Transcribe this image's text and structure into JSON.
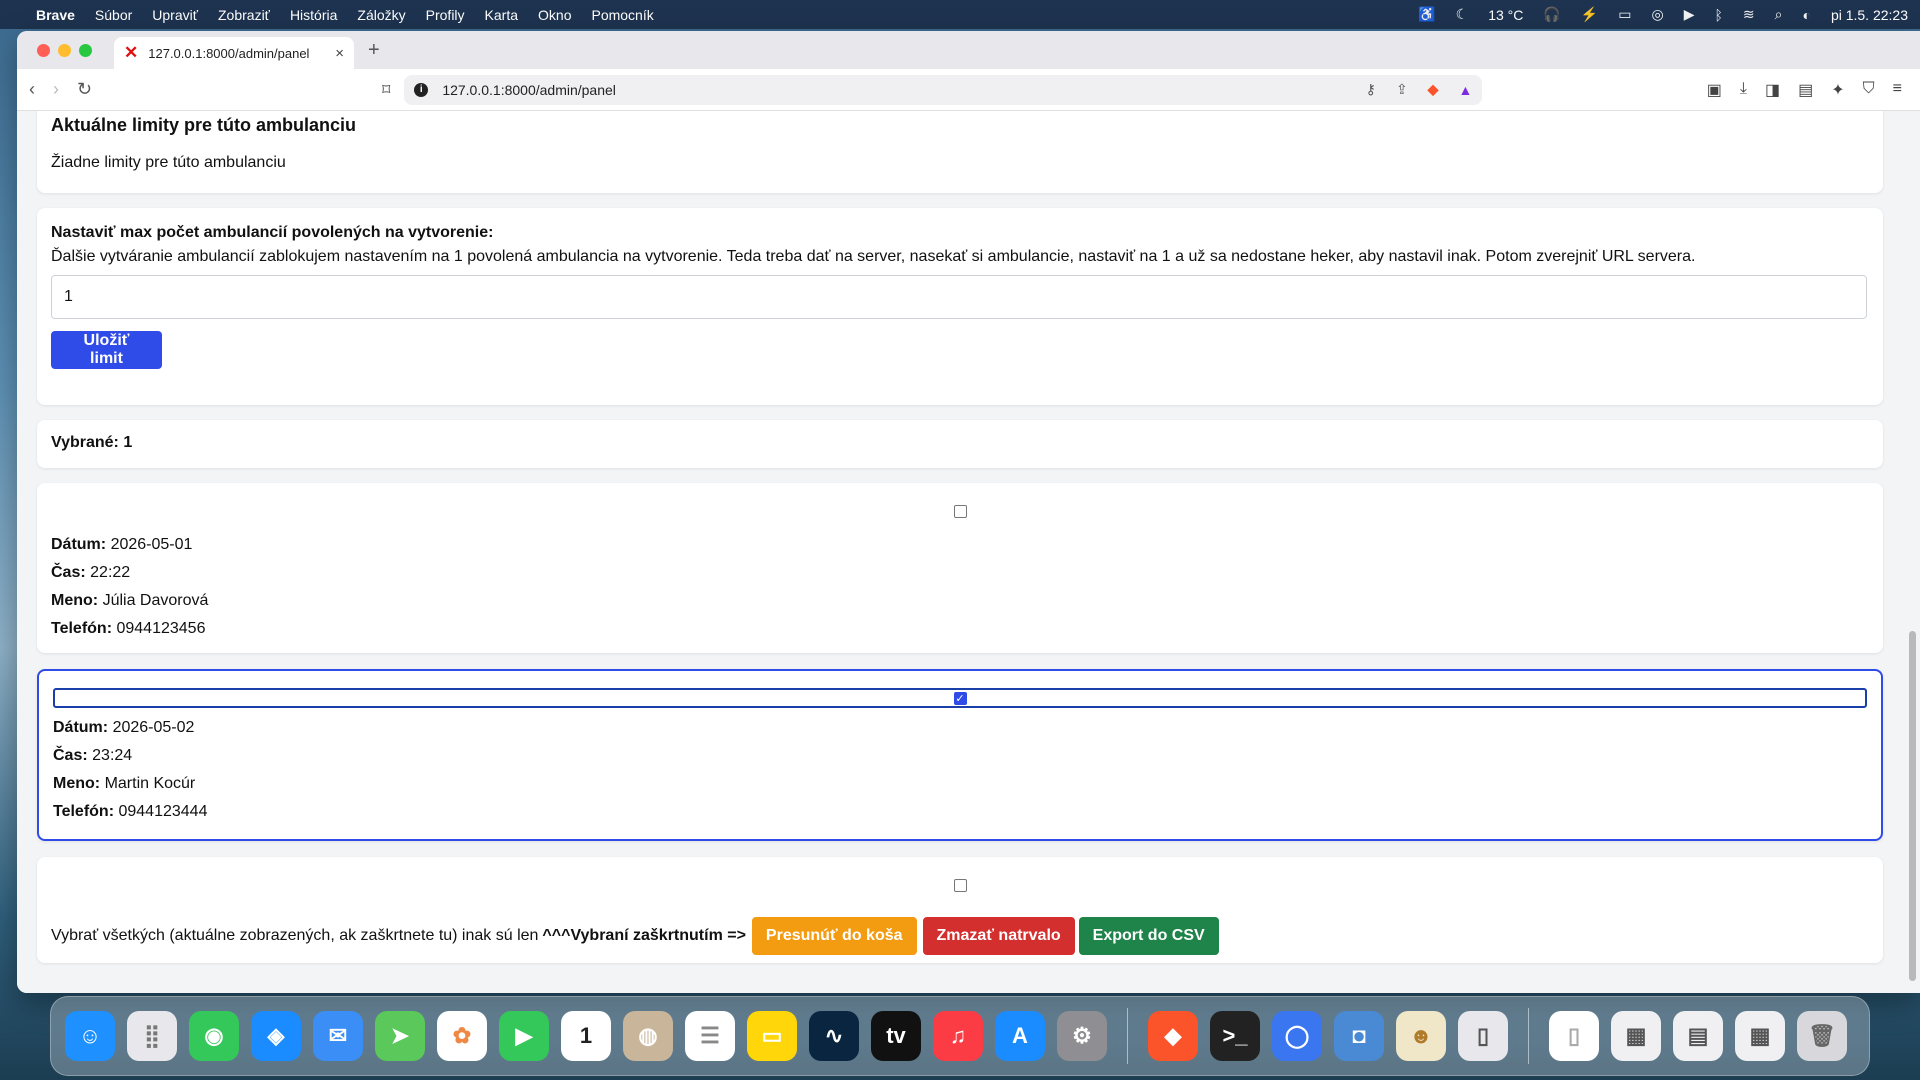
{
  "menubar": {
    "app": "Brave",
    "items": [
      "Súbor",
      "Upraviť",
      "Zobraziť",
      "História",
      "Záložky",
      "Profily",
      "Karta",
      "Okno",
      "Pomocník"
    ],
    "weather": "13 °C",
    "datetime": "pi 1.5.  22:23"
  },
  "browser": {
    "tab_title": "127.0.0.1:8000/admin/panel",
    "url": "127.0.0.1:8000/admin/panel"
  },
  "page": {
    "limits_title": "Aktuálne limity pre túto ambulanciu",
    "limits_text": "Žiadne limity pre túto ambulanciu",
    "max_label": "Nastaviť max počet ambulancií povolených na vytvorenie:",
    "max_desc": "Ďalšie vytváranie ambulancií zablokujem nastavením na 1 povolená ambulancia na vytvorenie. Teda treba dať na server, nasekať si ambulancie, nastaviť na 1 a už sa nedostane heker, aby nastavil inak. Potom zverejniť URL servera.",
    "max_value": "1",
    "save_button": "Uložiť limit",
    "selected_label": "Vybrané: 1"
  },
  "records": [
    {
      "checked": false,
      "date_label": "Dátum:",
      "date": "2026-05-01",
      "time_label": "Čas:",
      "time": "22:22",
      "name_label": "Meno:",
      "name": "Júlia Davorová",
      "phone_label": "Telefón:",
      "phone": "0944123456"
    },
    {
      "checked": true,
      "date_label": "Dátum:",
      "date": "2026-05-02",
      "time_label": "Čas:",
      "time": "23:24",
      "name_label": "Meno:",
      "name": "Martin Kocúr",
      "phone_label": "Telefón:",
      "phone": "0944123444"
    }
  ],
  "bulk": {
    "text": "Vybrať všetkých (aktuálne zobrazených, ak zaškrtnete tu) inak sú len",
    "strong": "^^^Vybraní zaškrtnutím =>",
    "trash_button": "Presunúť do koša",
    "delete_button": "Zmazať natrvalo",
    "export_button": "Export do CSV"
  },
  "colors": {
    "primary": "#2f4be8",
    "orange": "#f39c12",
    "red": "#d32f2f",
    "green": "#1e8449"
  }
}
